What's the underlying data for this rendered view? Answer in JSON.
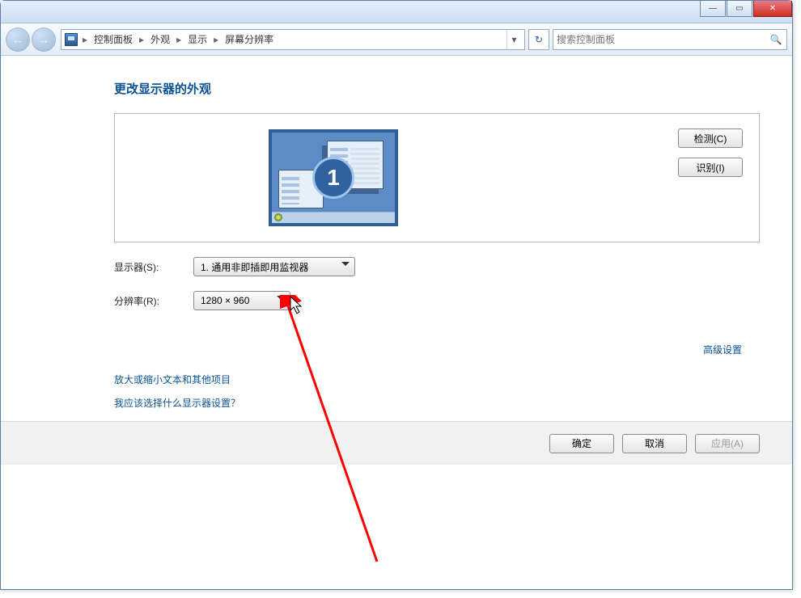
{
  "titlebar": {
    "minimize": "—",
    "maximize": "▭",
    "close": "✕"
  },
  "nav": {
    "back_arrow": "←",
    "fwd_arrow": "→",
    "crumbs": [
      "控制面板",
      "外观",
      "显示",
      "屏幕分辨率"
    ],
    "sep": "▸",
    "dropdown_glyph": "▾",
    "refresh_glyph": "↻"
  },
  "search": {
    "placeholder": "搜索控制面板",
    "icon": "🔍"
  },
  "heading": "更改显示器的外观",
  "monitor": {
    "badge": "1"
  },
  "buttons": {
    "detect": "检测(C)",
    "identify": "识别(I)"
  },
  "form": {
    "display_label": "显示器(S):",
    "display_value": "1. 通用非即插即用监视器",
    "resolution_label": "分辨率(R):",
    "resolution_value": "1280 × 960"
  },
  "advanced": "高级设置",
  "links": {
    "text_size": "放大或缩小文本和其他项目",
    "what_settings": "我应该选择什么显示器设置？"
  },
  "bottom": {
    "ok": "确定",
    "cancel": "取消",
    "apply": "应用(A)"
  }
}
